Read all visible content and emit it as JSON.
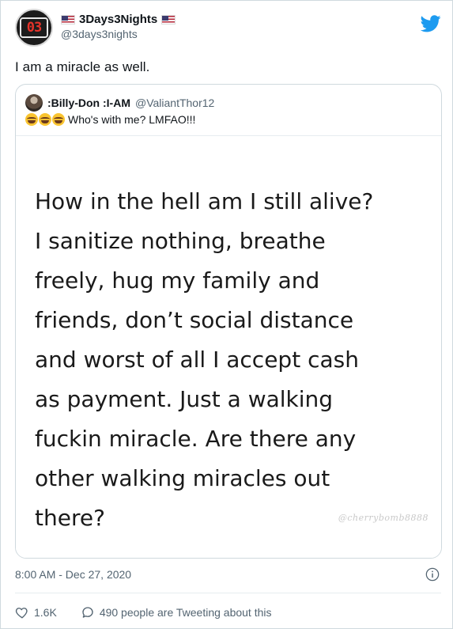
{
  "author": {
    "display_name": "3Days3Nights",
    "handle": "@3days3nights",
    "avatar_text": "03"
  },
  "tweet": {
    "text": "I am a miracle as well."
  },
  "quoted": {
    "display_name": ":Billy-Don :I-AM",
    "handle": "@ValiantThor12",
    "text": "Who's with me? LMFAO!!!",
    "emoji_count": 3,
    "image": {
      "lines": [
        "How in the hell am I still alive?",
        "I sanitize nothing, breathe",
        "freely, hug my family and",
        "friends, don’t social distance",
        "and worst of all I accept cash",
        "as payment. Just a walking",
        "fuckin miracle. Are there any",
        "other walking miracles out",
        "there?"
      ],
      "watermark": "@cherrybomb8888"
    }
  },
  "meta": {
    "timestamp": "8:00 AM - Dec 27, 2020"
  },
  "actions": {
    "likes": "1.6K",
    "tweeting": "490 people are Tweeting about this"
  },
  "colors": {
    "twitter_blue": "#1d9bf0",
    "muted": "#536471",
    "border": "#cfd9de"
  },
  "icons": {
    "logo": "twitter-bird-icon",
    "info": "info-icon",
    "like": "heart-icon",
    "reply": "speech-bubble-icon",
    "flag": "us-flag-icon"
  }
}
